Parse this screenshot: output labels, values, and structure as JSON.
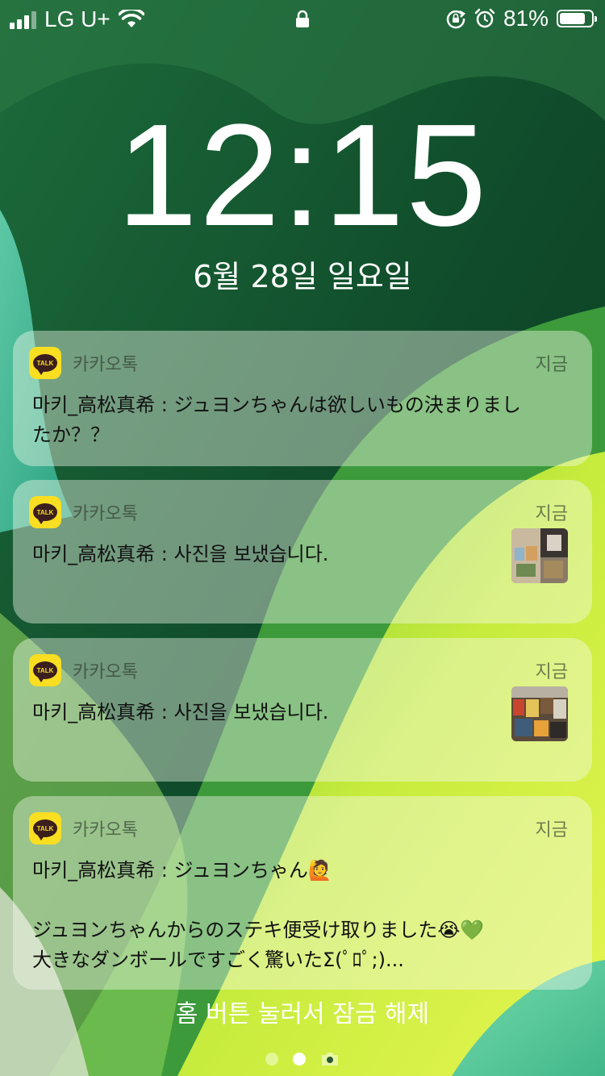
{
  "status_bar": {
    "carrier": "LG U+",
    "battery_percent": "81%",
    "battery_level": 0.81
  },
  "lock_screen": {
    "time": "12:15",
    "date": "6월 28일 일요일",
    "unlock_hint": "홈 버튼 눌러서 잠금 해제"
  },
  "notifications": [
    {
      "app_icon": "kakaotalk-icon",
      "app_icon_text": "TALK",
      "app": "카카오톡",
      "time": "지금",
      "message": "마키_高松真希 : ジュヨンちゃんは欲しいもの決まりましたか？？",
      "has_thumbnail": false
    },
    {
      "app_icon": "kakaotalk-icon",
      "app_icon_text": "TALK",
      "app": "카카오톡",
      "time": "지금",
      "message": "마키_高松真希 : 사진을 보냈습니다.",
      "has_thumbnail": true
    },
    {
      "app_icon": "kakaotalk-icon",
      "app_icon_text": "TALK",
      "app": "카카오톡",
      "time": "지금",
      "message": "마키_高松真希 : 사진을 보냈습니다.",
      "has_thumbnail": true
    },
    {
      "app_icon": "kakaotalk-icon",
      "app_icon_text": "TALK",
      "app": "카카오톡",
      "time": "지금",
      "message": "마키_高松真希 : ジュヨンちゃん🙋\n\nジュヨンちゃんからのステキ便受け取りました😭💚\n大きなダンボールですごく驚いたΣ(ﾟﾛﾟ;)...",
      "has_thumbnail": false
    }
  ],
  "page_indicator": {
    "pages": 2,
    "active_index": 1,
    "trailing_icon": "camera-icon"
  },
  "colors": {
    "kakao_yellow": "#f9de22",
    "kakao_brown": "#3b1e1e",
    "wallpaper_dark_green": "#0f4a2a",
    "wallpaper_lime": "#c9ef3a",
    "wallpaper_teal": "#3bc8b0"
  }
}
